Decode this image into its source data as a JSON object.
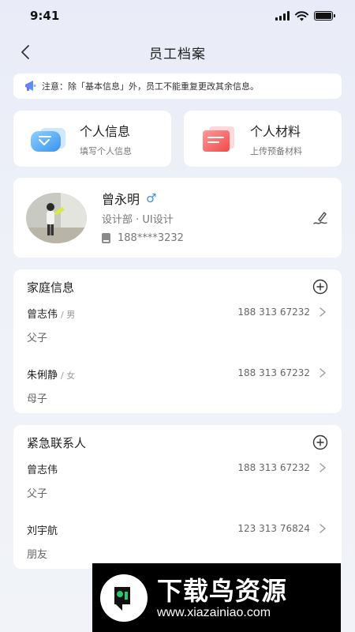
{
  "status_bar": {
    "time": "9:41"
  },
  "nav": {
    "title": "员工档案"
  },
  "notice": {
    "text": "注意：除「基本信息」外，员工不能重复更改其余信息。"
  },
  "quick_actions": [
    {
      "title": "个人信息",
      "subtitle": "填写个人信息",
      "icon": "id-card-icon",
      "color": "#4aa3f0"
    },
    {
      "title": "个人材料",
      "subtitle": "上传预备材料",
      "icon": "document-icon",
      "color": "#f06a6a"
    }
  ],
  "profile": {
    "name": "曾永明",
    "gender_symbol": "♂",
    "department": "设计部 · UI设计",
    "phone": "188****3232"
  },
  "family": {
    "title": "家庭信息",
    "members": [
      {
        "name": "曾志伟",
        "gender": "/ 男",
        "phone": "188 313 67232",
        "relation": "父子"
      },
      {
        "name": "朱俐静",
        "gender": "/ 女",
        "phone": "188 313 67232",
        "relation": "母子"
      }
    ]
  },
  "emergency": {
    "title": "紧急联系人",
    "contacts": [
      {
        "name": "曾志伟",
        "phone": "188 313 67232",
        "relation": "父子"
      },
      {
        "name": "刘宇航",
        "phone": "123 313 76824",
        "relation": "朋友"
      }
    ]
  },
  "watermark": {
    "title": "下载鸟资源",
    "url": "www.xiazainiao.com"
  },
  "colors": {
    "accent_blue": "#3d8ef0",
    "watermark_green": "#2ec46b"
  }
}
